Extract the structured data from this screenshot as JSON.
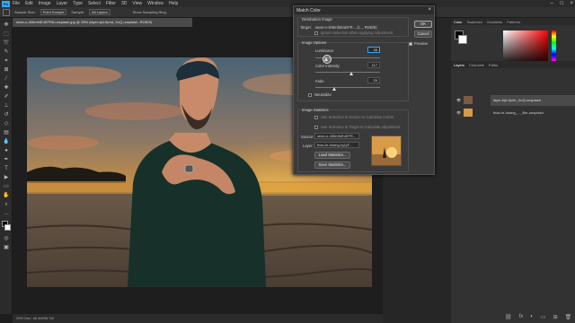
{
  "menu": {
    "logo": "Ps",
    "items": [
      "File",
      "Edit",
      "Image",
      "Layer",
      "Type",
      "Select",
      "Filter",
      "3D",
      "View",
      "Window",
      "Help"
    ]
  },
  "options_bar": {
    "sample_size_label": "Sample Size:",
    "sample_size": "Point Sample",
    "sample_label": "Sample:",
    "sample": "All Layers",
    "show_ring": "Show Sampling Ring"
  },
  "document_tab": "sean-o-406mfnEuEFR8-unsplash.jpg @ 25% (layer-kjd-9pmt_XoQ-unsplash, RGB/8)",
  "status_bar": "25%   Doc: 48.4M/96.7M",
  "dialog": {
    "title": "Match Color",
    "dest_section": "Destination Image",
    "target_label": "Target:",
    "target_value": "sean-o-406mfnEuEFR...  (t..., RGB/8)",
    "ignore_selection": "Ignore Selection when Applying Adjustment",
    "image_options": "Image Options",
    "luminance_label": "Luminance",
    "luminance": "38",
    "color_intensity_label": "Color Intensity",
    "color_intensity": "117",
    "fade_label": "Fade",
    "fade": "29",
    "neutralize": "Neutralize",
    "image_statistics": "Image Statistics",
    "use_sel_source": "Use Selection in Source to Calculate Colors",
    "use_sel_target": "Use Selection in Target to Calculate Adjustment",
    "source_label": "Source:",
    "source_value": "sean-o-406mfnEuEFR...",
    "layer_label": "Layer:",
    "layer_value": "thao-le-hoang-rgLyF...",
    "load_stats": "Load Statistics...",
    "save_stats": "Save Statistics...",
    "ok": "OK",
    "cancel": "Cancel",
    "preview": "Preview"
  },
  "right_panel": {
    "color_tabs": [
      "Color",
      "Swatches",
      "Gradients",
      "Patterns"
    ],
    "layers_tabs": [
      "Layers",
      "Channels",
      "Paths"
    ],
    "layers": [
      {
        "name": "layer-kjd-9pmt_XoQ-unsplash"
      },
      {
        "name": "thao-le-hoang_..._Bsr-unsplash"
      }
    ]
  },
  "colors": {
    "accent": "#31a8ff",
    "dialog_bg": "#3a3a3a",
    "app_bg": "#1e1e1e"
  }
}
